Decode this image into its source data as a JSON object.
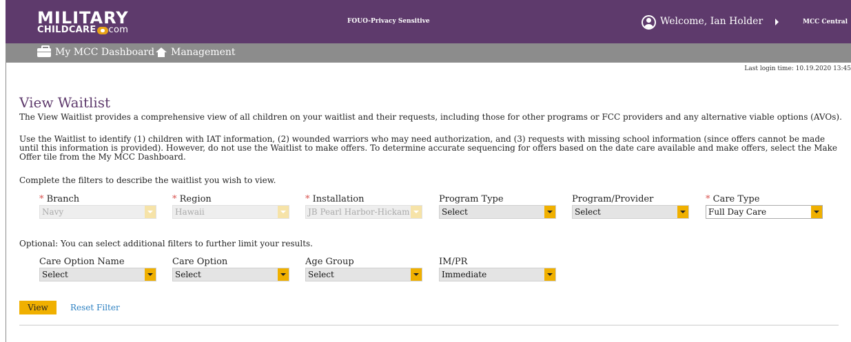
{
  "header": {
    "logo_main": "MILITARY",
    "logo_sub_care": "CHILDCARE",
    "logo_sub_com": "com",
    "classification": "FOUO-Privacy Sensitive",
    "welcome": "Welcome, Ian Holder",
    "mcc_central": "MCC Central",
    "brand_color": "#5e3a6c"
  },
  "nav": {
    "dashboard": "My MCC Dashboard",
    "management": "Management",
    "bar_color": "#8c8c8c"
  },
  "last_login": "Last login time: 10.19.2020 13:45",
  "page": {
    "title": "View Waitlist",
    "intro": "The View Waitlist provides a comprehensive view of all children on your waitlist and their requests, including those for other programs or FCC providers and any alternative viable options (AVOs).",
    "usage": "Use the Waitlist to identify (1) children with IAT information, (2) wounded warriors who may need authorization, and (3) requests with missing school information (since offers cannot be made until this information is provided). However, do not use the Waitlist to make offers. To determine accurate sequencing for offers based on the date care available and make offers, select the Make Offer tile from the My MCC Dashboard.",
    "filters_intro": "Complete the filters to describe the waitlist you wish to view.",
    "optional_intro": "Optional: You can select additional filters to further limit your results."
  },
  "filters": {
    "required_marker": "*",
    "branch": {
      "label": "Branch",
      "value": "Navy"
    },
    "region": {
      "label": "Region",
      "value": "Hawaii"
    },
    "installation": {
      "label": "Installation",
      "value": "JB Pearl Harbor-Hickam"
    },
    "program_type": {
      "label": "Program Type",
      "value": "Select"
    },
    "program_provider": {
      "label": "Program/Provider",
      "value": "Select"
    },
    "care_type": {
      "label": "Care Type",
      "value": "Full Day Care"
    }
  },
  "optional_filters": {
    "care_option_name": {
      "label": "Care Option Name",
      "value": "Select"
    },
    "care_option": {
      "label": "Care Option",
      "value": "Select"
    },
    "age_group": {
      "label": "Age Group",
      "value": "Select"
    },
    "im_pr": {
      "label": "IM/PR",
      "value": "Immediate"
    }
  },
  "actions": {
    "view": "View",
    "reset": "Reset Filter",
    "accent_color": "#f0b000"
  }
}
